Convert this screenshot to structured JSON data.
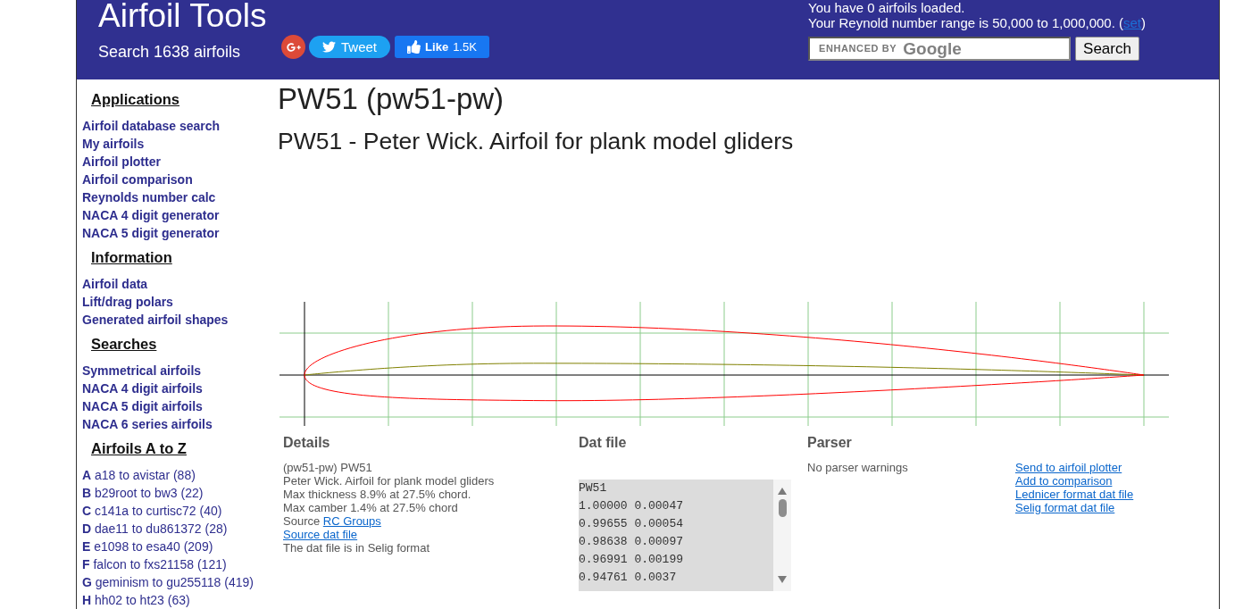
{
  "header": {
    "title": "Airfoil Tools",
    "subtitle": "Search 1638 airfoils",
    "tweet": {
      "label": "Tweet"
    },
    "like": {
      "label": "Like",
      "count": "1.5K"
    },
    "status": "You have 0 airfoils loaded.",
    "reynolds": {
      "before": "Your Reynold number range is 50,000 to 1,000,000. (",
      "link": "set",
      "after": ")"
    },
    "search": {
      "branding": "ENHANCED BY",
      "brand": "Google",
      "button": "Search"
    }
  },
  "sidebar": {
    "sections": [
      {
        "kind": "menu",
        "heading": "Applications",
        "links": [
          "Airfoil database search",
          "My airfoils",
          "Airfoil plotter",
          "Airfoil comparison",
          "Reynolds number calc",
          "NACA 4 digit generator",
          "NACA 5 digit generator"
        ]
      },
      {
        "kind": "menu",
        "heading": "Information",
        "links": [
          "Airfoil data",
          "Lift/drag polars",
          "Generated airfoil shapes"
        ]
      },
      {
        "kind": "menu",
        "heading": "Searches",
        "links": [
          "Symmetrical airfoils",
          "NACA 4 digit airfoils",
          "NACA 5 digit airfoils",
          "NACA 6 series airfoils"
        ]
      },
      {
        "kind": "index",
        "heading": "Airfoils A to Z",
        "links": [
          "**A** a18 to avistar (88)",
          "**B** b29root to bw3 (22)",
          "**C** c141a to curtisc72 (40)",
          "**D** dae11 to du861372 (28)",
          "**E** e1098 to esa40 (209)",
          "**F** falcon to fxs21158 (121)",
          "**G** geminism to gu255118 (419)",
          "**H** hh02 to ht23 (63)"
        ]
      }
    ]
  },
  "main": {
    "title": "PW51 (pw51-pw)",
    "subtitle": "PW51 - Peter Wick. Airfoil for plank model gliders",
    "details": {
      "heading": "Details",
      "lines": [
        {
          "kind": "text",
          "text": "(pw51-pw) PW51"
        },
        {
          "kind": "text",
          "text": "Peter Wick. Airfoil for plank model gliders"
        },
        {
          "kind": "text",
          "text": "Max thickness 8.9% at 27.5% chord."
        },
        {
          "kind": "text",
          "text": "Max camber 1.4% at 27.5% chord"
        },
        {
          "kind": "text_link",
          "text": "Source ",
          "link": "RC Groups"
        },
        {
          "kind": "link",
          "text": "Source dat file"
        },
        {
          "kind": "text",
          "text": "The dat file is in Selig format"
        }
      ]
    },
    "dat_file": {
      "heading": "Dat file",
      "lines": [
        "PW51",
        "1.00000 0.00047",
        "0.99655 0.00054",
        "0.98638 0.00097",
        "0.96991 0.00199",
        "0.94761 0.0037"
      ]
    },
    "parser": {
      "heading": "Parser",
      "message": "No parser warnings"
    },
    "actions": [
      "Send to airfoil plotter",
      "Add to comparison",
      "Lednicer format dat file",
      "Selig format dat file"
    ]
  }
}
